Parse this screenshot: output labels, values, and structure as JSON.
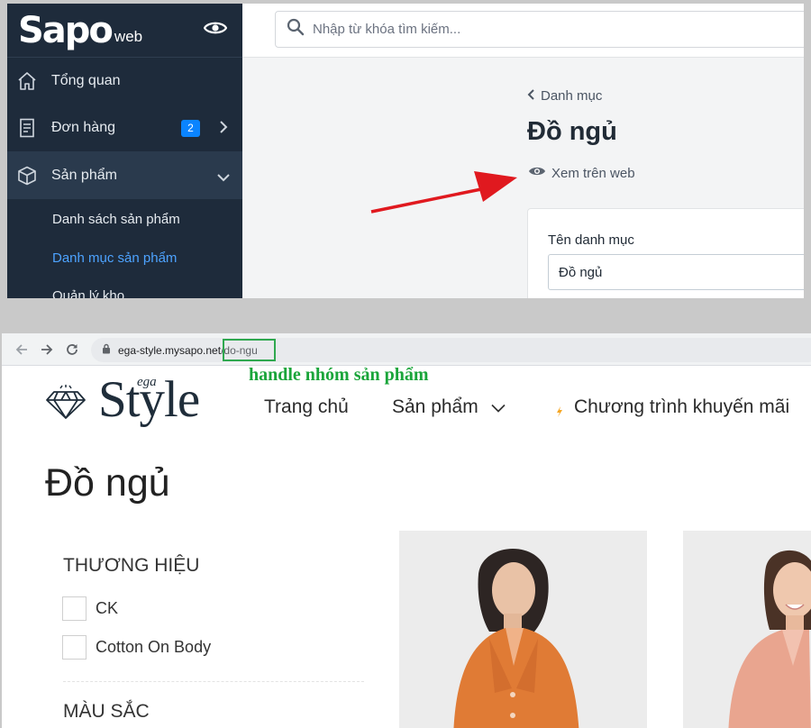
{
  "admin": {
    "logo_main": "Sapo",
    "logo_sub": "web",
    "search_placeholder": "Nhập từ khóa tìm kiếm...",
    "sidebar": {
      "overview": "Tổng quan",
      "orders": "Đơn hàng",
      "orders_badge": "2",
      "products": "Sản phẩm",
      "sub_items": [
        "Danh sách sản phẩm",
        "Danh mục sản phẩm",
        "Quản lý kho"
      ]
    },
    "breadcrumb": "Danh mục",
    "title": "Đồ ngủ",
    "view_web": "Xem trên web",
    "card": {
      "label": "Tên danh mục",
      "value": "Đồ ngủ"
    },
    "arrow_color": "#e0191f",
    "accent": "#4da3ff"
  },
  "store": {
    "url_host": "ega-style.mysapo.net",
    "url_path": "/do-ngu",
    "handle_label": "handle nhóm sản phẩm",
    "handle_color": "#1aa53a",
    "logo_style": "Style",
    "logo_ega": "ega",
    "menu": [
      "Trang chủ",
      "Sản phẩm",
      "Chương trình khuyến mãi"
    ],
    "page_title": "Đồ ngủ",
    "filters": {
      "brand_heading": "THƯƠNG HIỆU",
      "brands": [
        "CK",
        "Cotton On Body"
      ],
      "color_heading": "MÀU SẮC"
    }
  }
}
